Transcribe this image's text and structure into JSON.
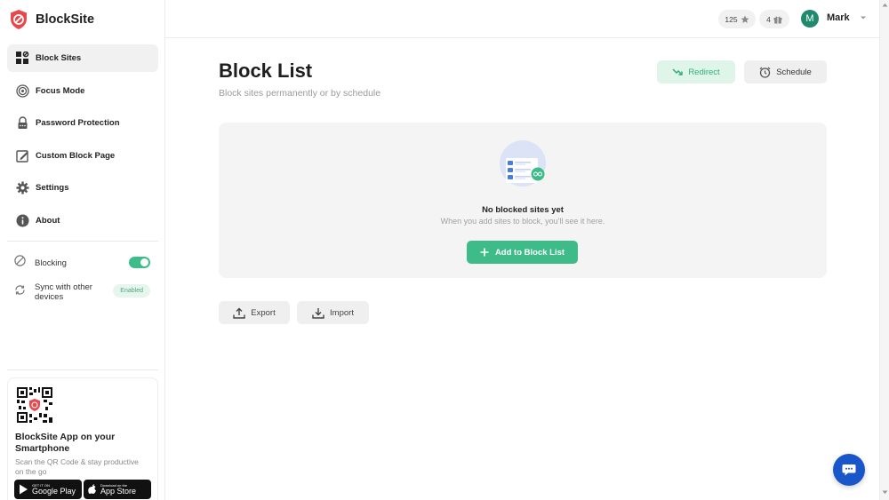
{
  "brand": {
    "name": "BlockSite"
  },
  "sidebar": {
    "items": [
      {
        "label": "Block Sites",
        "icon": "grid-block-icon",
        "active": true
      },
      {
        "label": "Focus Mode",
        "icon": "target-icon"
      },
      {
        "label": "Password Protection",
        "icon": "lock-icon"
      },
      {
        "label": "Custom Block Page",
        "icon": "edit-page-icon"
      },
      {
        "label": "Settings",
        "icon": "gear-icon"
      },
      {
        "label": "About",
        "icon": "info-icon"
      }
    ],
    "blocking": {
      "label": "Blocking",
      "enabled": true
    },
    "sync": {
      "label": "Sync with other devices",
      "badge": "Enabled"
    }
  },
  "promo": {
    "title": "BlockSite App on your Smartphone",
    "subtitle": "Scan the QR Code & stay productive on the go",
    "google_play": {
      "small": "GET IT ON",
      "big": "Google Play"
    },
    "app_store": {
      "small": "Download on the",
      "big": "App Store"
    }
  },
  "topbar": {
    "stars_count": "125",
    "gifts_count": "4",
    "avatar_letter": "M",
    "user_name": "Mark"
  },
  "main": {
    "title": "Block List",
    "subtitle": "Block sites permanently or by schedule",
    "redirect_label": "Redirect",
    "schedule_label": "Schedule",
    "empty_title": "No blocked sites yet",
    "empty_subtitle": "When you add sites to block, you'll see it here.",
    "add_label": "Add to Block List",
    "export_label": "Export",
    "import_label": "Import"
  },
  "colors": {
    "accent": "#3dbc8a",
    "brand_red": "#e5484d",
    "chat": "#1856c9"
  }
}
